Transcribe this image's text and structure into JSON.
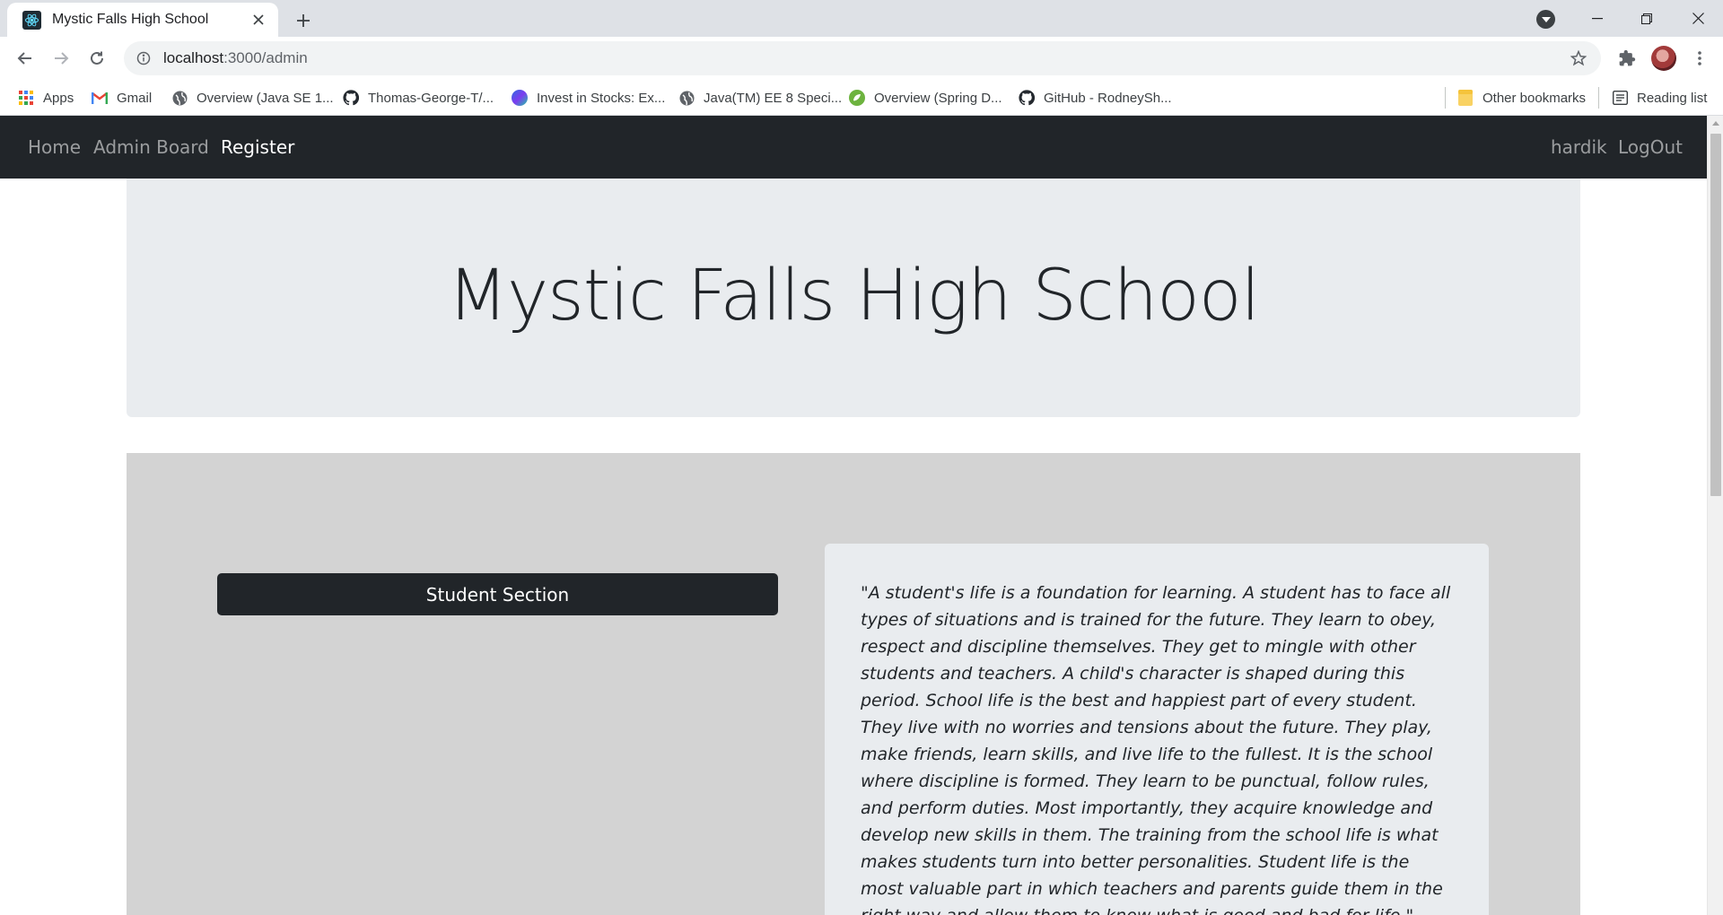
{
  "browser": {
    "tab_title": "Mystic Falls High School",
    "url_host": "localhost",
    "url_rest": ":3000/admin",
    "bookmarks": [
      {
        "label": "Apps",
        "icon": "apps-grid-icon"
      },
      {
        "label": "Gmail",
        "icon": "gmail-icon"
      },
      {
        "label": "Overview (Java SE 1...",
        "icon": "globe-icon"
      },
      {
        "label": "Thomas-George-T/...",
        "icon": "github-icon"
      },
      {
        "label": "Invest in Stocks: Ex...",
        "icon": "stocks-icon"
      },
      {
        "label": "Java(TM) EE 8 Speci...",
        "icon": "globe-icon"
      },
      {
        "label": "Overview (Spring D...",
        "icon": "spring-icon"
      },
      {
        "label": "GitHub - RodneySh...",
        "icon": "github-icon"
      }
    ],
    "other_bookmarks": "Other bookmarks",
    "reading_list": "Reading list"
  },
  "nav": {
    "home": "Home",
    "admin_board": "Admin Board",
    "register": "Register",
    "username": "hardik",
    "logout": "LogOut"
  },
  "header": {
    "title": "Mystic Falls High School"
  },
  "main": {
    "student_button": "Student Section",
    "quote": "\"A student's life is a foundation for learning. A student has to face all types of situations and is trained for the future. They learn to obey, respect and discipline themselves. They get to mingle with other students and teachers. A child's character is shaped during this period. School life is the best and happiest part of every student. They live with no worries and tensions about the future. They play, make friends, learn skills, and live life to the fullest. It is the school where discipline is formed. They learn to be punctual, follow rules, and perform duties. Most importantly, they acquire knowledge and develop new skills in them. The training from the school life is what makes students turn into better personalities. Student life is the most valuable part in which teachers and parents guide them in the right way and allow them to know what is good and bad for life.\""
  },
  "colors": {
    "navbar": "#212529",
    "jumbotron": "#e9ecef",
    "panel": "#d3d3d3",
    "button": "#212529"
  }
}
